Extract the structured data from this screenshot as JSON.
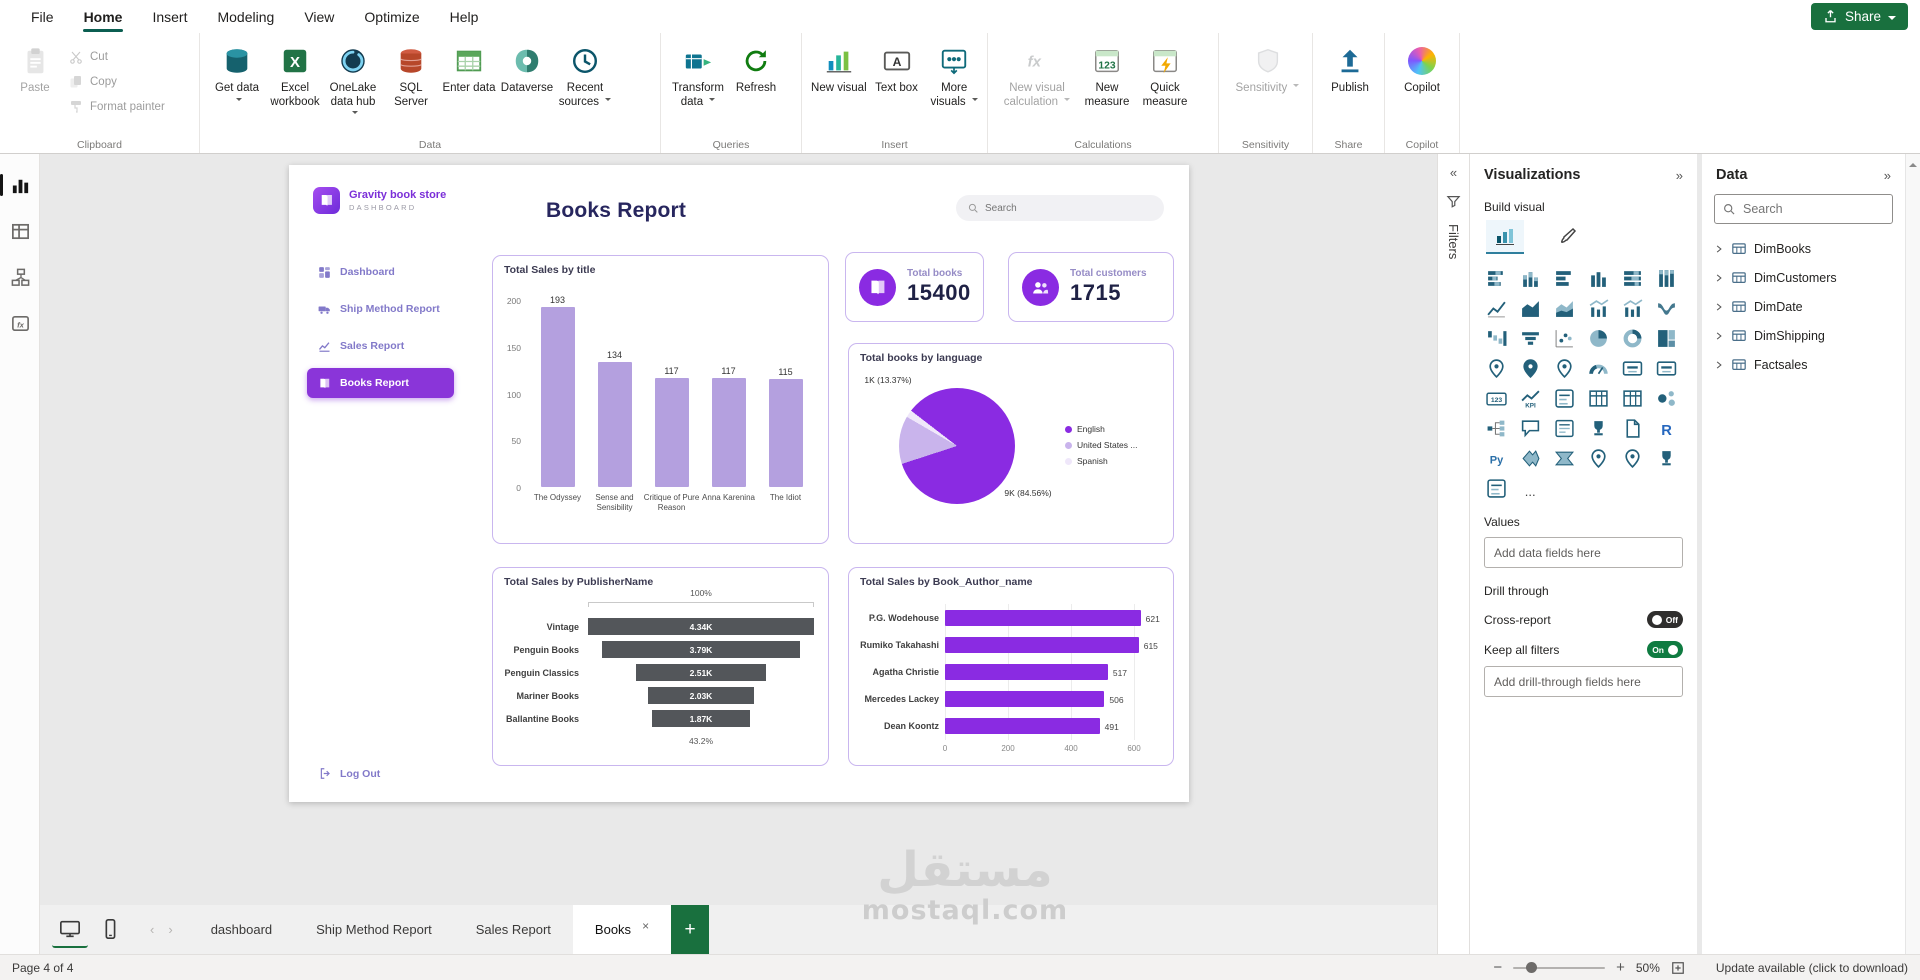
{
  "menubar": {
    "items": [
      "File",
      "Home",
      "Insert",
      "Modeling",
      "View",
      "Optimize",
      "Help"
    ],
    "active": "Home",
    "share_label": "Share"
  },
  "ribbon": {
    "groups": [
      {
        "label": "Clipboard",
        "type": "clipboard",
        "big": {
          "label": "Paste",
          "icon": "paste",
          "disabled": true
        },
        "small": [
          {
            "label": "Cut",
            "icon": "cut",
            "disabled": true
          },
          {
            "label": "Copy",
            "icon": "copy",
            "disabled": true
          },
          {
            "label": "Format painter",
            "icon": "format-painter",
            "disabled": true
          }
        ]
      },
      {
        "label": "Data",
        "buttons": [
          {
            "label": "Get data",
            "icon": "get-data",
            "dropdown": true
          },
          {
            "label": "Excel workbook",
            "icon": "excel"
          },
          {
            "label": "OneLake data hub",
            "icon": "onelake",
            "dropdown": true
          },
          {
            "label": "SQL Server",
            "icon": "sql-server"
          },
          {
            "label": "Enter data",
            "icon": "enter-data"
          },
          {
            "label": "Dataverse",
            "icon": "dataverse"
          },
          {
            "label": "Recent sources",
            "icon": "recent",
            "dropdown": true
          }
        ]
      },
      {
        "label": "Queries",
        "buttons": [
          {
            "label": "Transform data",
            "icon": "transform",
            "dropdown": true
          },
          {
            "label": "Refresh",
            "icon": "refresh"
          }
        ]
      },
      {
        "label": "Insert",
        "buttons": [
          {
            "label": "New visual",
            "icon": "new-visual"
          },
          {
            "label": "Text box",
            "icon": "text-box"
          },
          {
            "label": "More visuals",
            "icon": "more-visuals",
            "dropdown": true
          }
        ]
      },
      {
        "label": "Calculations",
        "buttons": [
          {
            "label": "New visual calculation",
            "icon": "fx",
            "dropdown": true,
            "disabled": true,
            "wide": true
          },
          {
            "label": "New measure",
            "icon": "new-measure"
          },
          {
            "label": "Quick measure",
            "icon": "quick-measure"
          }
        ]
      },
      {
        "label": "Sensitivity",
        "buttons": [
          {
            "label": "Sensitivity",
            "icon": "sensitivity",
            "dropdown": true,
            "disabled": true,
            "wide": true
          }
        ]
      },
      {
        "label": "Share",
        "buttons": [
          {
            "label": "Publish",
            "icon": "publish"
          }
        ]
      },
      {
        "label": "Copilot",
        "buttons": [
          {
            "label": "Copilot",
            "icon": "copilot"
          }
        ]
      }
    ]
  },
  "left_rail": [
    {
      "name": "report-view",
      "active": true
    },
    {
      "name": "table-view"
    },
    {
      "name": "model-view"
    },
    {
      "name": "dax-query-view"
    }
  ],
  "report": {
    "brand": {
      "title": "Gravity book store",
      "subtitle": "DASHBOARD"
    },
    "nav": [
      {
        "label": "Dashboard",
        "icon": "dashboard"
      },
      {
        "label": "Ship Method Report",
        "icon": "truck"
      },
      {
        "label": "Sales Report",
        "icon": "sales"
      },
      {
        "label": "Books Report",
        "icon": "book",
        "active": true
      }
    ],
    "logout_label": "Log Out",
    "title": "Books Report",
    "search_placeholder": "Search",
    "kpis": [
      {
        "label": "Total books",
        "value": "15400",
        "icon": "books"
      },
      {
        "label": "Total customers",
        "value": "1715",
        "icon": "customers"
      }
    ]
  },
  "chart_data": [
    {
      "type": "bar",
      "title": "Total Sales by title",
      "categories": [
        "The Odyssey",
        "Sense and Sensibility",
        "Critique of Pure Reason",
        "Anna Karenina",
        "The Idiot"
      ],
      "values": [
        193,
        134,
        117,
        117,
        115
      ],
      "xlabel": "",
      "ylabel": "",
      "ylim": [
        0,
        200
      ],
      "yticks": [
        0,
        50,
        100,
        150,
        200
      ],
      "grid": false,
      "bar_color": "#b4a0df"
    },
    {
      "type": "pie",
      "title": "Total books by language",
      "slices": [
        {
          "label": "English",
          "pct": 84.56,
          "value_label": "9K (84.56%)",
          "color": "#8a2be2"
        },
        {
          "label": "United States ...",
          "pct": 13.37,
          "value_label": "1K (13.37%)",
          "color": "#c9b4ec"
        },
        {
          "label": "Spanish",
          "pct": 2.07,
          "value_label": "",
          "color": "#efe7fa"
        }
      ],
      "legend_position": "right"
    },
    {
      "type": "funnel",
      "title": "Total Sales by PublisherName",
      "categories": [
        "Vintage",
        "Penguin Books",
        "Penguin Classics",
        "Mariner Books",
        "Ballantine Books"
      ],
      "values": [
        4340,
        3790,
        2510,
        2030,
        1870
      ],
      "value_labels": [
        "4.34K",
        "3.79K",
        "2.51K",
        "2.03K",
        "1.87K"
      ],
      "top_axis_label": "100%",
      "bottom_label": "43.2%",
      "bar_color": "#53565a"
    },
    {
      "type": "bar",
      "orientation": "horizontal",
      "title": "Total Sales by Book_Author_name",
      "categories": [
        "P.G. Wodehouse",
        "Rumiko Takahashi",
        "Agatha Christie",
        "Mercedes Lackey",
        "Dean Koontz"
      ],
      "values": [
        621,
        615,
        517,
        506,
        491
      ],
      "xticks": [
        0,
        200,
        400,
        600
      ],
      "xlim": [
        0,
        650
      ],
      "grid": true,
      "bar_color": "#8a2be2"
    }
  ],
  "panels": {
    "filters": {
      "title": "Filters"
    },
    "visualizations": {
      "title": "Visualizations",
      "build_label": "Build visual",
      "values_label": "Values",
      "values_placeholder": "Add data fields here",
      "drill_label": "Drill through",
      "cross_report_label": "Cross-report",
      "cross_report_state": "Off",
      "keep_filters_label": "Keep all filters",
      "keep_filters_state": "On",
      "drill_placeholder": "Add drill-through fields here",
      "more_label": "...",
      "icons": [
        "stacked-bar-chart",
        "stacked-column-chart",
        "clustered-bar-chart",
        "clustered-column-chart",
        "hundred-percent-stacked-bar-chart",
        "hundred-percent-stacked-column-chart",
        "line-chart",
        "area-chart",
        "stacked-area-chart",
        "line-and-stacked-column-chart",
        "line-and-clustered-column-chart",
        "ribbon-chart",
        "waterfall-chart",
        "funnel-chart",
        "scatter-chart",
        "pie-chart",
        "donut-chart",
        "treemap",
        "map",
        "filled-map",
        "shape-map",
        "gauge",
        "card",
        "multi-row-card",
        "new-card",
        "kpi",
        "slicer",
        "table",
        "matrix",
        "key-influencers",
        "decomposition-tree",
        "qa-visual",
        "smart-narrative",
        "metrics",
        "paginated-report",
        "r-script-visual",
        "python-visual",
        "power-apps",
        "power-automate",
        "arcgis-map",
        "azure-map",
        "scorecard",
        "button-slicer"
      ]
    },
    "data": {
      "title": "Data",
      "search_placeholder": "Search",
      "tables": [
        "DimBooks",
        "DimCustomers",
        "DimDate",
        "DimShipping",
        "Factsales"
      ]
    }
  },
  "pages": {
    "tabs": [
      {
        "label": "dashboard"
      },
      {
        "label": "Ship Method Report"
      },
      {
        "label": "Sales Report"
      },
      {
        "label": "Books",
        "active": true,
        "closable": true
      }
    ],
    "add_label": "+"
  },
  "statusbar": {
    "page_info": "Page 4 of 4",
    "zoom": "50%",
    "update_text": "Update available (click to download)"
  },
  "watermark": {
    "line1": "مستقل",
    "line2": "mostaql.com"
  }
}
